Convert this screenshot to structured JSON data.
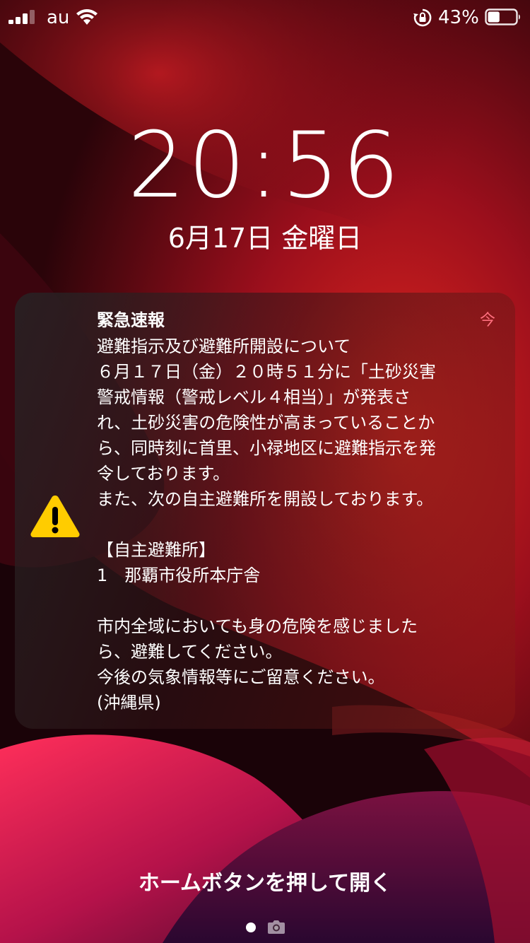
{
  "status_bar": {
    "carrier": "au",
    "battery_percent": "43%",
    "battery_level": 0.43,
    "signal_bars_active": 3,
    "signal_icon": "cellular-signal-icon",
    "wifi_icon": "wifi-icon",
    "rotation_icon": "rotation-lock-icon",
    "battery_icon": "battery-icon"
  },
  "lock_screen": {
    "time": "20:56",
    "date": "6月17日 金曜日"
  },
  "notification": {
    "icon": "warning-icon",
    "title": "緊急速報",
    "time": "今",
    "time_color": "#ff6f7e",
    "lines": [
      "避難指示及び避難所開設について",
      "６月１７日（金）２０時５１分に「土砂災害",
      "警戒情報（警戒レベル４相当）」が発表さ",
      "れ、土砂災害の危険性が高まっていることか",
      "ら、同時刻に首里、小禄地区に避難指示を発",
      "令しております。",
      "また、次の自主避難所を開設しております。",
      "【自主避難所】",
      "1　那覇市役所本庁舎",
      "市内全域においても身の危険を感じました",
      "ら、避難してください。",
      "今後の気象情報等にご留意ください。",
      "(沖縄県)"
    ]
  },
  "bottom": {
    "home_hint": "ホームボタンを押して開く",
    "camera_icon": "camera-icon"
  },
  "colors": {
    "warning_yellow": "#ffcc00",
    "wallpaper_red": "#c2141d"
  }
}
